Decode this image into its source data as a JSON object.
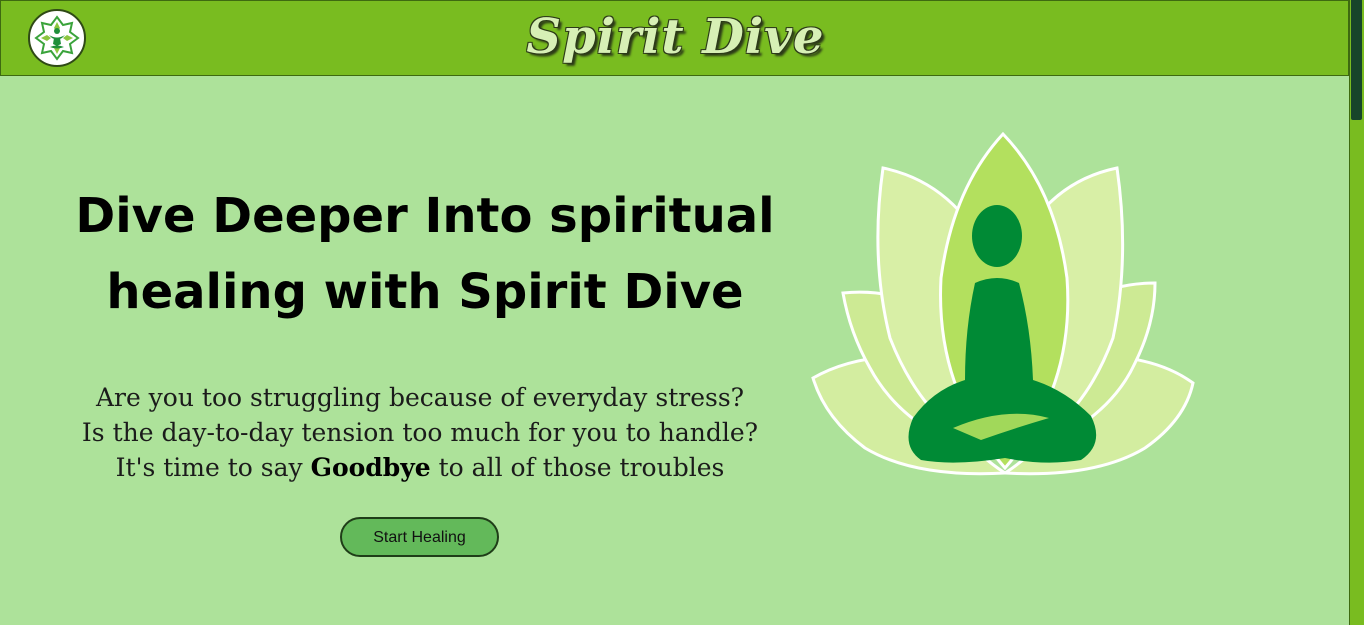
{
  "header": {
    "brand": "Spirit Dive"
  },
  "hero": {
    "title": "Dive Deeper Into spiritual healing with Spirit Dive",
    "line1": "Are you too struggling because of everyday stress?",
    "line2": "Is the day-to-day tension too much for you to handle?",
    "line3_prefix": "It's time to say ",
    "line3_bold": "Goodbye",
    "line3_suffix": " to all of those troubles",
    "cta_label": "Start Healing"
  },
  "colors": {
    "navbar": "#79bc20",
    "background": "#ade29a",
    "button": "#63b95a",
    "figure": "#008a35"
  },
  "icons": {
    "logo": "lotus-meditation-logo-icon",
    "illustration": "meditating-figure-lotus-icon"
  }
}
